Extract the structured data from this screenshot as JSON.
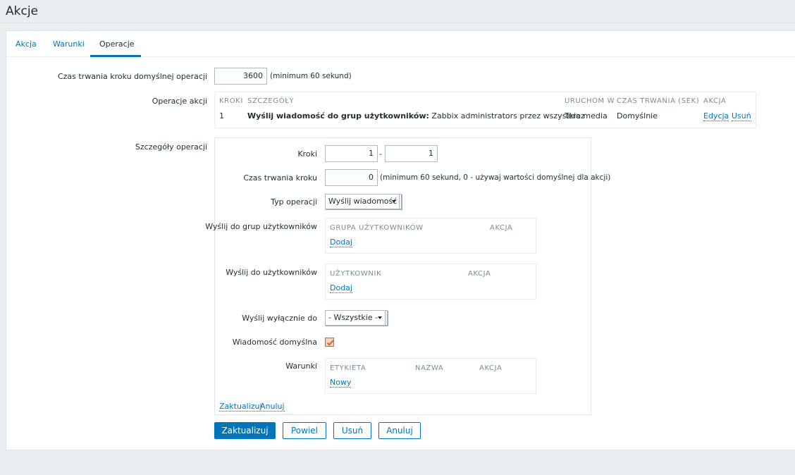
{
  "page": {
    "title": "Akcje"
  },
  "tabs": [
    {
      "label": "Akcja"
    },
    {
      "label": "Warunki"
    },
    {
      "label": "Operacje"
    }
  ],
  "default_step": {
    "label": "Czas trwania kroku domyślnej operacji",
    "value": "3600",
    "hint": "(minimum 60 sekund)"
  },
  "operations": {
    "label": "Operacje akcji",
    "headers": [
      "KROKI",
      "SZCZEGÓŁY",
      "URUCHOM W",
      "CZAS TRWANIA (SEK)",
      "AKCJA"
    ],
    "rows": [
      {
        "step": "1",
        "details_bold": "Wyślij wiadomość do grup użytkowników:",
        "details_rest": " Zabbix administrators przez wszystkie media",
        "start_in": "Teraz",
        "duration": "Domyślnie",
        "edit": "Edycja",
        "remove": "Usuń"
      }
    ]
  },
  "details": {
    "label": "Szczegóły operacji",
    "steps": {
      "label": "Kroki",
      "from": "1",
      "dash": "-",
      "to": "1"
    },
    "step_duration": {
      "label": "Czas trwania kroku",
      "value": "0",
      "hint": "(minimum 60 sekund, 0 - używaj wartości domyślnej dla akcji)"
    },
    "op_type": {
      "label": "Typ operacji",
      "value": "Wyślij wiadomość"
    },
    "send_groups": {
      "label": "Wyślij do grup użytkowników",
      "h1": "GRUPA UŻYTKOWNIKÓW",
      "h2": "AKCJA",
      "add": "Dodaj"
    },
    "send_users": {
      "label": "Wyślij do użytkowników",
      "h1": "UŻYTKOWNIK",
      "h2": "AKCJA",
      "add": "Dodaj"
    },
    "send_only": {
      "label": "Wyślij wyłącznie do",
      "value": "- Wszystkie -"
    },
    "default_msg": {
      "label": "Wiadomość domyślna",
      "checked": true
    },
    "conditions": {
      "label": "Warunki",
      "h1": "ETYKIETA",
      "h2": "NAZWA",
      "h3": "AKCJA",
      "new": "Nowy"
    },
    "update_link": "Zaktualizuj",
    "cancel_link": "Anuluj"
  },
  "buttons": {
    "update": "Zaktualizuj",
    "clone": "Powiel",
    "delete": "Usuń",
    "cancel": "Anuluj"
  },
  "colors": {
    "accent": "#0275b8",
    "checkbox": "#d26529"
  }
}
